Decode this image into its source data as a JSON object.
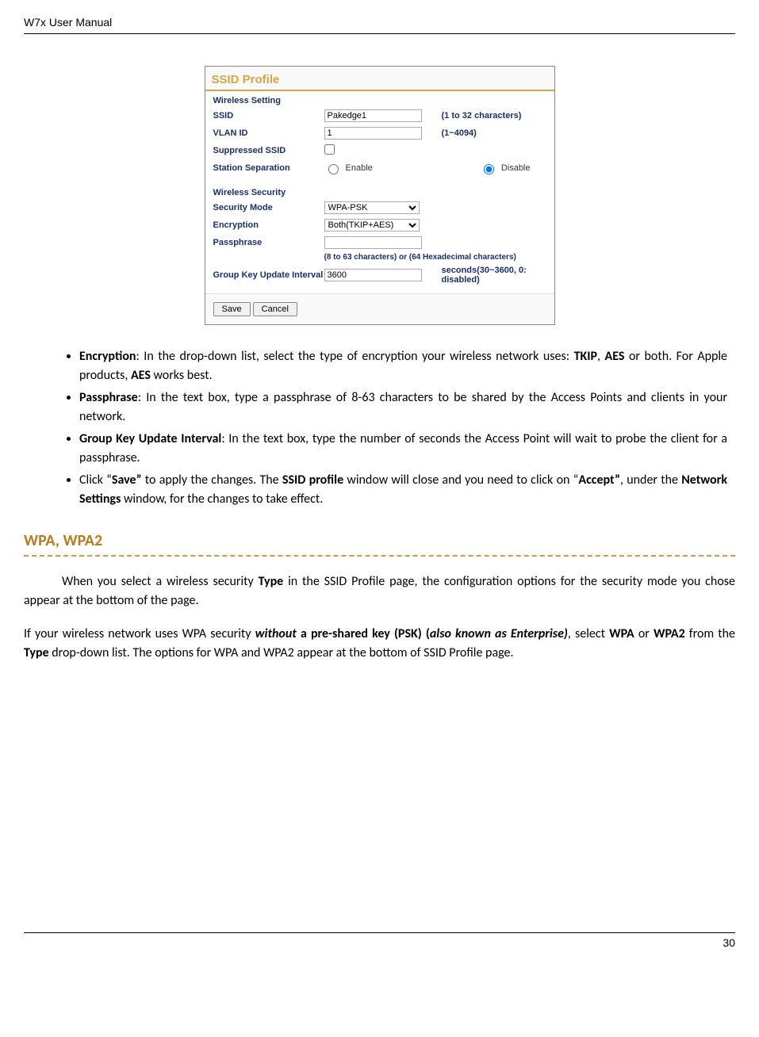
{
  "header": {
    "title": "W7x  User Manual"
  },
  "screenshot": {
    "tab_title": "SSID Profile",
    "section_wireless_setting": "Wireless Setting",
    "ssid": {
      "label": "SSID",
      "value": "Pakedge1",
      "hint": "(1 to 32 characters)"
    },
    "vlan": {
      "label": "VLAN ID",
      "value": "1",
      "hint": "(1~4094)"
    },
    "suppressed": {
      "label": "Suppressed SSID"
    },
    "separation": {
      "label": "Station Separation",
      "enable": "Enable",
      "disable": "Disable"
    },
    "section_wireless_security": "Wireless Security",
    "security_mode": {
      "label": "Security Mode",
      "value": "WPA-PSK"
    },
    "encryption": {
      "label": "Encryption",
      "value": "Both(TKIP+AES)"
    },
    "passphrase": {
      "label": "Passphrase",
      "value": "",
      "hint": "(8 to 63 characters) or (64 Hexadecimal characters)"
    },
    "group_key": {
      "label": "Group Key Update Interval",
      "value": "3600",
      "hint": "seconds(30~3600, 0: disabled)"
    },
    "buttons": {
      "save": "Save",
      "cancel": "Cancel"
    }
  },
  "bullets": {
    "b1": {
      "label": "Encryption",
      "text": ": In the drop-down list, select the type of encryption your wireless network uses: ",
      "tkip": "TKIP",
      "sep": ", ",
      "aes": "AES",
      "or": " or both. For Apple products, ",
      "aes2": "AES",
      "end": " works best."
    },
    "b2": {
      "label": "Passphrase",
      "text": ": In the text box, type a passphrase of 8-63 characters to be shared by the Access Points and clients in your network."
    },
    "b3": {
      "label": "Group Key Update Interval",
      "text": ": In the text box, type the number of seconds the Access Point will wait to probe the client for a passphrase."
    },
    "b4": {
      "pre": "Click “",
      "save": "Save”",
      "mid": " to apply the changes. The ",
      "ssid": "SSID profile",
      "mid2": " window will close and you need to click on “",
      "accept": "Accept”",
      "mid3": ", under the ",
      "ns": "Network Settings",
      "end": " window, for the changes to take effect."
    }
  },
  "section": {
    "title": "WPA, WPA2"
  },
  "para1": {
    "pre": "When you select a wireless security ",
    "type": "Type",
    "post": " in the SSID Profile page, the configuration options for the security mode you chose appear at the bottom of the page."
  },
  "para2": {
    "pre": "If your wireless network uses WPA security ",
    "without": "without",
    "mid": " a pre-shared key (PSK) (",
    "aka": "also known as Enterprise)",
    "mid2": ", select ",
    "wpa": "WPA",
    "or": " or ",
    "wpa2": "WPA2",
    "mid3": " from the ",
    "type": "Type",
    "end": " drop-down list. The options for WPA and WPA2 appear at the bottom of SSID Profile page."
  },
  "footer": {
    "page": "30"
  }
}
